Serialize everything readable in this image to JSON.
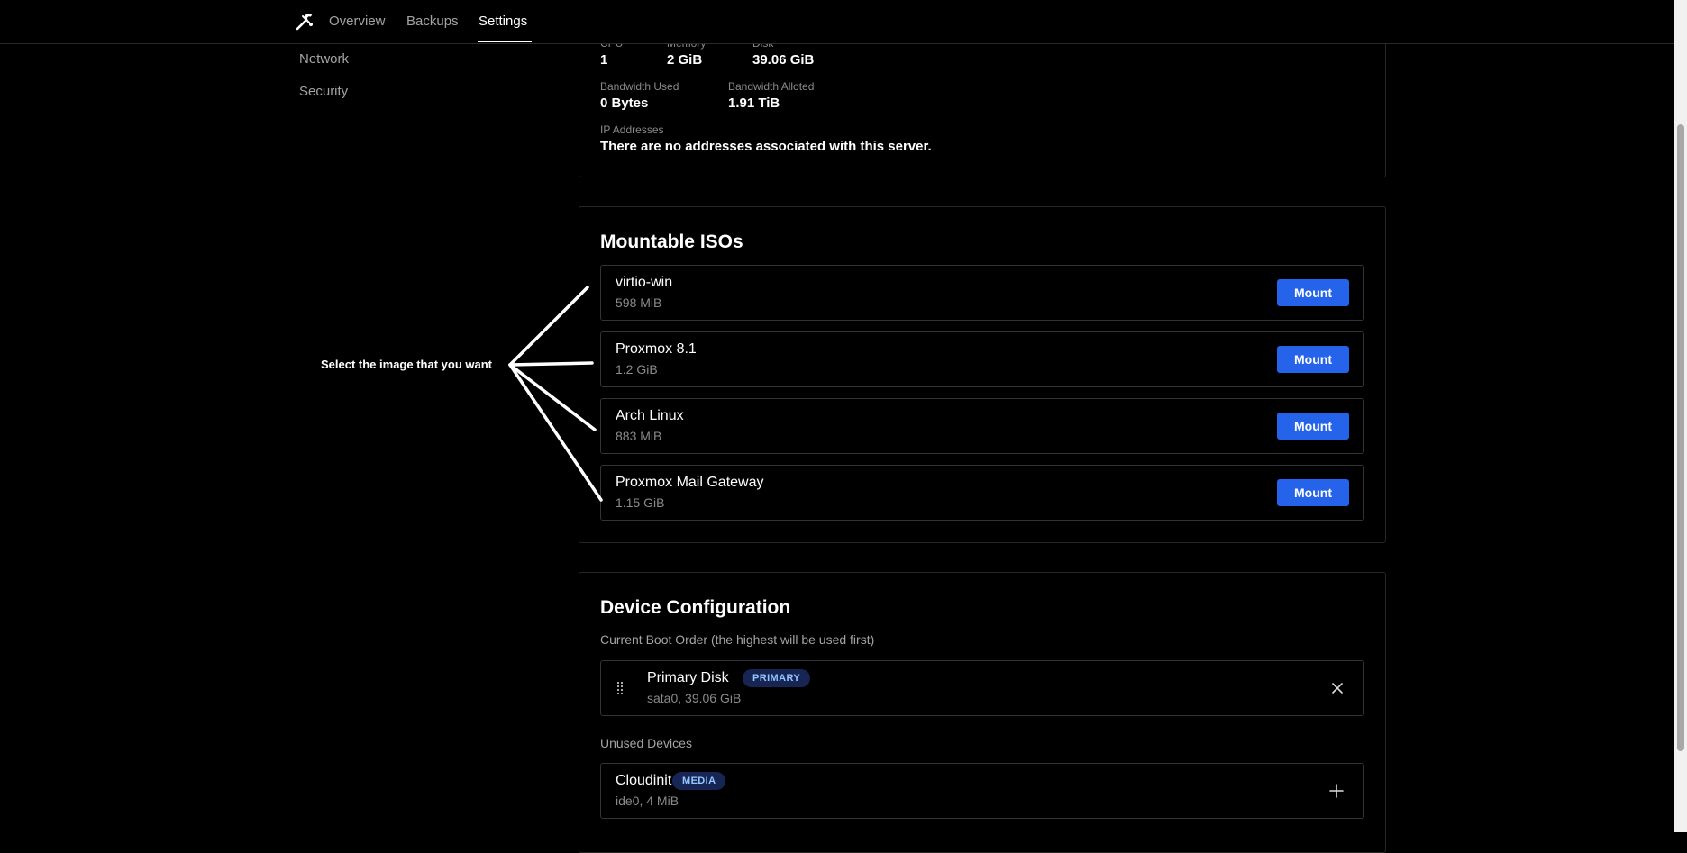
{
  "nav": {
    "logo_icon": "hammer-wrench-icon",
    "tabs": [
      {
        "label": "Overview"
      },
      {
        "label": "Backups"
      },
      {
        "label": "Settings"
      }
    ],
    "active_tab": "Settings"
  },
  "sidebar": {
    "items": [
      {
        "label": "Network"
      },
      {
        "label": "Security"
      }
    ]
  },
  "specs": {
    "cpu": {
      "label": "CPU",
      "value": "1"
    },
    "memory": {
      "label": "Memory",
      "value": "2 GiB"
    },
    "disk": {
      "label": "Disk",
      "value": "39.06 GiB"
    },
    "bandwidth_used": {
      "label": "Bandwidth Used",
      "value": "0 Bytes"
    },
    "bandwidth_alloted": {
      "label": "Bandwidth Alloted",
      "value": "1.91 TiB"
    },
    "ip": {
      "label": "IP Addresses",
      "value": "There are no addresses associated with this server."
    }
  },
  "isos": {
    "title": "Mountable ISOs",
    "mount_label": "Mount",
    "items": [
      {
        "name": "virtio-win",
        "size": "598 MiB"
      },
      {
        "name": "Proxmox 8.1",
        "size": "1.2 GiB"
      },
      {
        "name": "Arch Linux",
        "size": "883 MiB"
      },
      {
        "name": "Proxmox Mail Gateway",
        "size": "1.15 GiB"
      }
    ]
  },
  "devices": {
    "title": "Device Configuration",
    "boot_order_label": "Current Boot Order (the highest will be used first)",
    "boot": {
      "name": "Primary Disk",
      "badge": "PRIMARY",
      "detail": "sata0, 39.06 GiB",
      "drag_icon": "drag-handle-icon",
      "action_icon": "close-icon"
    },
    "unused_label": "Unused Devices",
    "unused": {
      "name": "Cloudinit",
      "badge": "MEDIA",
      "detail": "ide0, 4 MiB",
      "action_icon": "plus-icon"
    }
  },
  "annotation": {
    "text": "Select the image that you want"
  },
  "colors": {
    "background": "#000000",
    "accent": "#2563eb",
    "badge_bg": "#172554",
    "badge_text": "#93c5fd",
    "muted_text": "#8a8a8a",
    "border": "#333333"
  }
}
